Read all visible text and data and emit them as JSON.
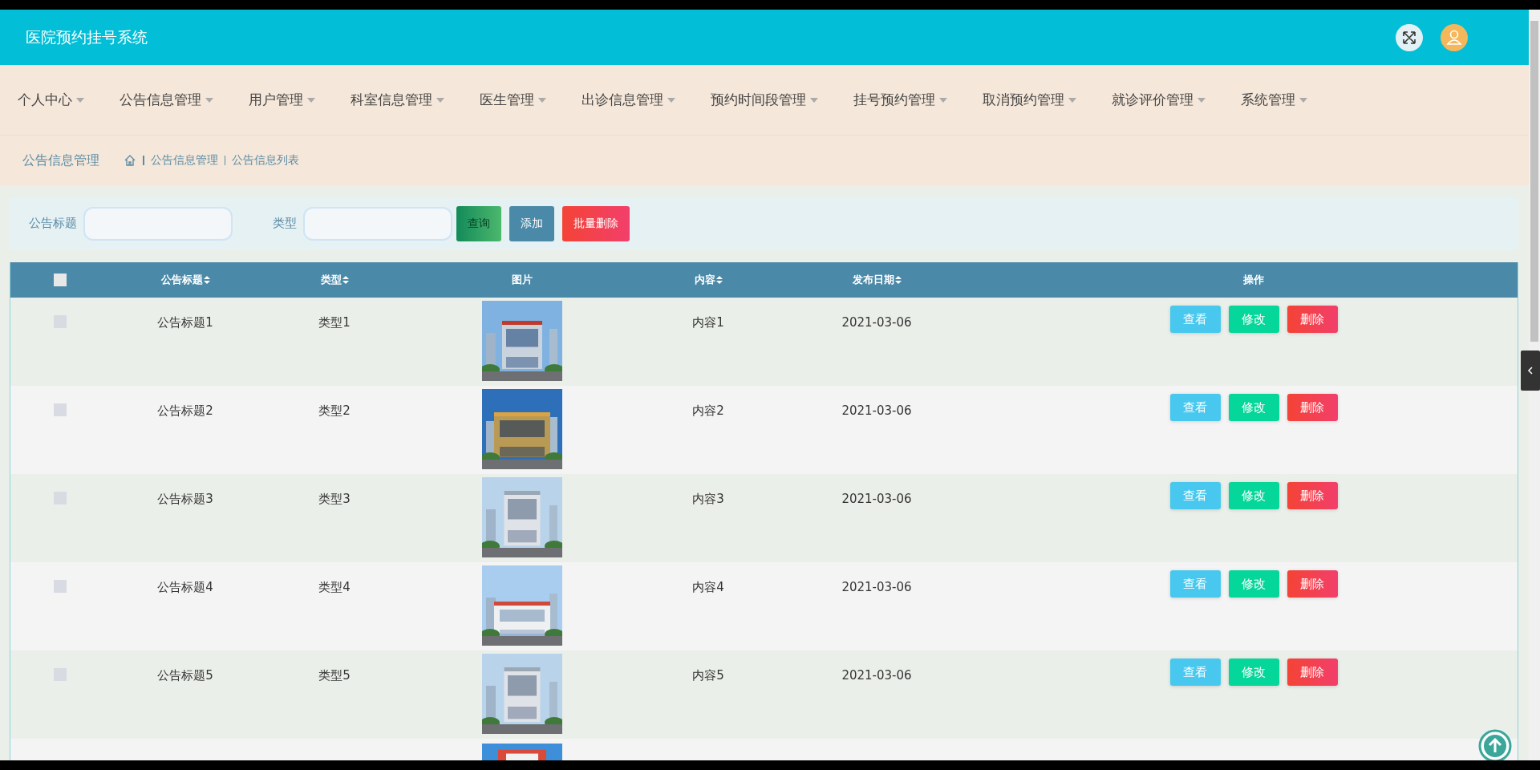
{
  "header": {
    "title": "医院预约挂号系统"
  },
  "nav": [
    {
      "label": "个人中心"
    },
    {
      "label": "公告信息管理"
    },
    {
      "label": "用户管理"
    },
    {
      "label": "科室信息管理"
    },
    {
      "label": "医生管理"
    },
    {
      "label": "出诊信息管理"
    },
    {
      "label": "预约时间段管理"
    },
    {
      "label": "挂号预约管理"
    },
    {
      "label": "取消预约管理"
    },
    {
      "label": "就诊评价管理"
    },
    {
      "label": "系统管理"
    }
  ],
  "breadcrumb": {
    "page_title": "公告信息管理",
    "trail": [
      "公告信息管理",
      "公告信息列表"
    ]
  },
  "search": {
    "fields": [
      {
        "label": "公告标题"
      },
      {
        "label": "类型"
      }
    ],
    "buttons": [
      {
        "label": "查询",
        "kind": "query"
      },
      {
        "label": "添加",
        "kind": "add"
      },
      {
        "label": "批量删除",
        "kind": "batch-delete"
      }
    ]
  },
  "table": {
    "select_all_checked": false,
    "columns": [
      {
        "label": "公告标题",
        "sortable": true
      },
      {
        "label": "类型",
        "sortable": true
      },
      {
        "label": "图片",
        "sortable": false
      },
      {
        "label": "内容",
        "sortable": true
      },
      {
        "label": "发布日期",
        "sortable": true
      },
      {
        "label": "操作",
        "sortable": false
      }
    ],
    "rows": [
      {
        "checked": false,
        "title": "公告标题1",
        "type": "类型1",
        "content": "内容1",
        "date": "2021-03-06",
        "actions": [
          {
            "label": "查看",
            "kind": "view"
          },
          {
            "label": "修改",
            "kind": "edit"
          },
          {
            "label": "删除",
            "kind": "delete"
          }
        ]
      },
      {
        "checked": false,
        "title": "公告标题2",
        "type": "类型2",
        "content": "内容2",
        "date": "2021-03-06",
        "actions": [
          {
            "label": "查看",
            "kind": "view"
          },
          {
            "label": "修改",
            "kind": "edit"
          },
          {
            "label": "删除",
            "kind": "delete"
          }
        ]
      },
      {
        "checked": false,
        "title": "公告标题3",
        "type": "类型3",
        "content": "内容3",
        "date": "2021-03-06",
        "actions": [
          {
            "label": "查看",
            "kind": "view"
          },
          {
            "label": "修改",
            "kind": "edit"
          },
          {
            "label": "删除",
            "kind": "delete"
          }
        ]
      },
      {
        "checked": false,
        "title": "公告标题4",
        "type": "类型4",
        "content": "内容4",
        "date": "2021-03-06",
        "actions": [
          {
            "label": "查看",
            "kind": "view"
          },
          {
            "label": "修改",
            "kind": "edit"
          },
          {
            "label": "删除",
            "kind": "delete"
          }
        ]
      },
      {
        "checked": false,
        "title": "公告标题5",
        "type": "类型5",
        "content": "内容5",
        "date": "2021-03-06",
        "actions": [
          {
            "label": "查看",
            "kind": "view"
          },
          {
            "label": "修改",
            "kind": "edit"
          },
          {
            "label": "删除",
            "kind": "delete"
          }
        ]
      }
    ]
  }
}
